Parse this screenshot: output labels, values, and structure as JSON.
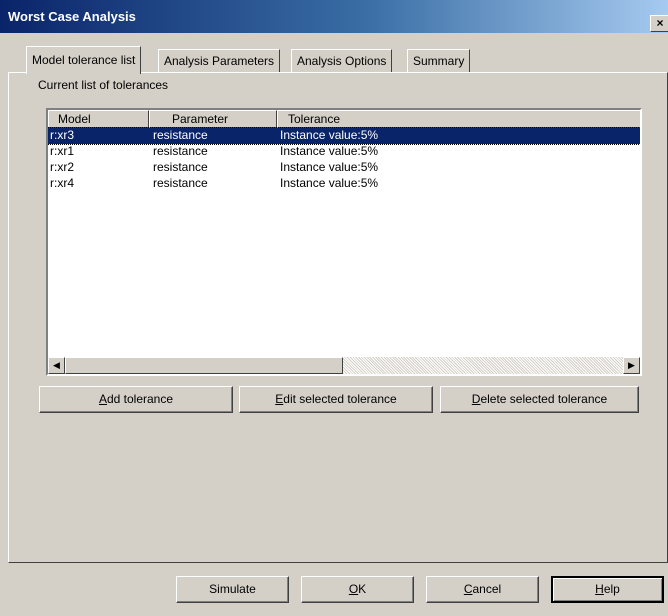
{
  "window": {
    "title": "Worst Case Analysis",
    "close_glyph": "×"
  },
  "tabs": [
    {
      "label": "Model tolerance list",
      "active": true
    },
    {
      "label": "Analysis Parameters",
      "active": false
    },
    {
      "label": "Analysis Options",
      "active": false
    },
    {
      "label": "Summary",
      "active": false
    }
  ],
  "panel": {
    "group_label": "Current list of tolerances",
    "columns": [
      "Model",
      "Parameter",
      "Tolerance"
    ],
    "rows": [
      {
        "model": "r:xr3",
        "parameter": "resistance",
        "tolerance": "Instance value:5%",
        "selected": true
      },
      {
        "model": "r:xr1",
        "parameter": "resistance",
        "tolerance": "Instance value:5%",
        "selected": false
      },
      {
        "model": "r:xr2",
        "parameter": "resistance",
        "tolerance": "Instance value:5%",
        "selected": false
      },
      {
        "model": "r:xr4",
        "parameter": "resistance",
        "tolerance": "Instance value:5%",
        "selected": false
      }
    ],
    "buttons": {
      "add": {
        "accel": "A",
        "rest": "dd tolerance"
      },
      "edit": {
        "accel": "E",
        "rest": "dit selected tolerance"
      },
      "delete": {
        "accel": "D",
        "rest": "elete selected tolerance"
      }
    }
  },
  "footer": {
    "simulate": "Simulate",
    "ok": {
      "accel": "O",
      "rest": "K"
    },
    "cancel": {
      "accel": "C",
      "rest": "ancel"
    },
    "help": {
      "accel": "H",
      "rest": "elp"
    }
  },
  "icons": {
    "scroll_left": "◀",
    "scroll_right": "▶"
  },
  "colors": {
    "selection": "#0a246a",
    "title_start": "#0a246a",
    "title_end": "#a6caf0",
    "face": "#d4d0c8"
  }
}
